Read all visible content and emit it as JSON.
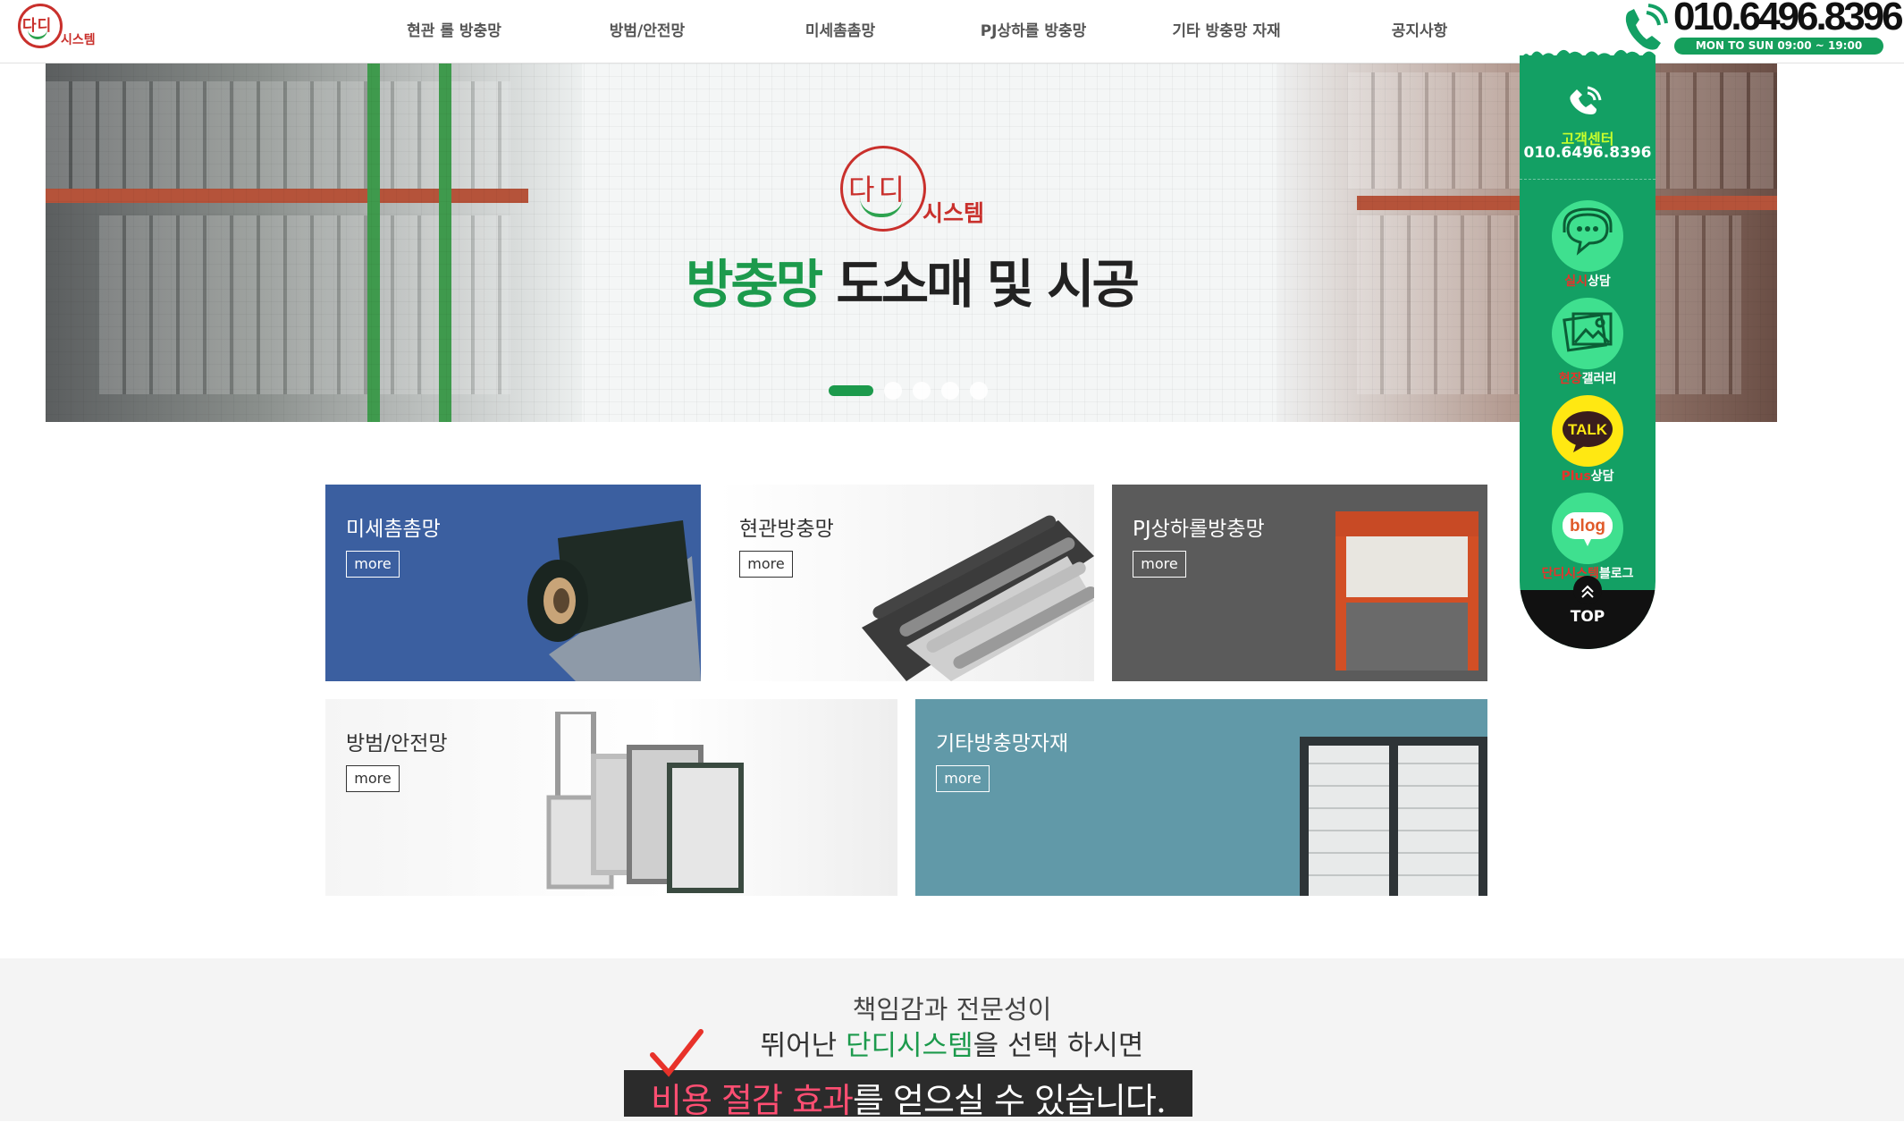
{
  "header": {
    "logo_main": "다디",
    "logo_sub": "시스템",
    "nav": [
      "현관 롤 방충망",
      "방범/안전망",
      "미세촘촘망",
      "PJ상하롤 방충망",
      "기타 방충망 자재",
      "공지사항"
    ],
    "phone": "010.6496.8396",
    "hours": "MON TO SUN   09:00 ~ 19:00"
  },
  "hero": {
    "logo_main": "다디",
    "logo_sub": "시스템",
    "title_green": "방충망",
    "title_dark": "도소매 및 시공",
    "slide_count": 5,
    "active_slide": 1
  },
  "products": [
    {
      "title": "미세촘촘망",
      "more": "more"
    },
    {
      "title": "현관방충망",
      "more": "more"
    },
    {
      "title": "PJ상하롤방충망",
      "more": "more"
    },
    {
      "title": "방범/안전망",
      "more": "more"
    },
    {
      "title": "기타방충망자재",
      "more": "more"
    }
  ],
  "sidebar": {
    "cs_label": "고객센터",
    "cs_number": "010.6496.8396",
    "items": [
      {
        "highlight": "실시",
        "label": "상담"
      },
      {
        "highlight": "현장",
        "label": "갤러리"
      },
      {
        "highlight": "Plus",
        "label": "상담",
        "icon_text": "TALK"
      },
      {
        "highlight": "단디시스템",
        "label": "블로그",
        "icon_text": "blog"
      }
    ],
    "top_label": "TOP"
  },
  "bottom": {
    "line1": "책임감과 전문성이",
    "line2_pre": "뛰어난 ",
    "line2_green": "단디시스템",
    "line2_post": "을 선택 하시면",
    "line3_red": "비용 절감 효과",
    "line3_post": "를 얻으실 수 있습니다."
  },
  "colors": {
    "brand_green": "#13a064",
    "brand_red": "#c9302c",
    "accent_pink": "#ff4e72"
  }
}
